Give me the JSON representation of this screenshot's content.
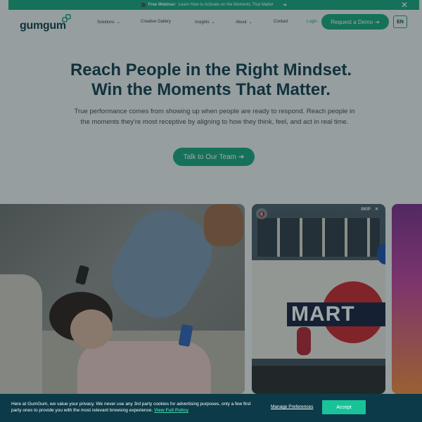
{
  "announcement": {
    "emoji": "🎥",
    "bold_label": "Free Webinar:",
    "text": "Learn How to Activate on the Moments That Matter",
    "arrow": "➜",
    "close": "✕"
  },
  "header": {
    "logo_text": "gumgum",
    "nav": [
      {
        "label": "Solutions",
        "has_chevron": true
      },
      {
        "label": "Creative Gallery",
        "has_chevron": false
      },
      {
        "label": "Insights",
        "has_chevron": true
      },
      {
        "label": "About",
        "has_chevron": true
      },
      {
        "label": "Contact",
        "has_chevron": false
      }
    ],
    "chevron": "⌄",
    "login": "Login",
    "demo_label": "Request a Demo",
    "demo_arrow": "➔",
    "lang": "EN"
  },
  "hero": {
    "title_line1": "Reach People in the Right Mindset.",
    "title_line2": "Win the Moments That Matter.",
    "subtitle": "True performance comes from showing up when people are ready to respond. Reach people in the moments they're most receptive by aligning to how they think, feel, and act in real time.",
    "cta_label": "Talk to Our Team",
    "cta_arrow": "➔"
  },
  "media": {
    "card2_word": "MART",
    "skip_label": "SKIP",
    "skip_close": "✕",
    "sound_icon": "🔇"
  },
  "cookie": {
    "text": "Here at GumGum, we value your privacy. We never use any 3rd party cookies for advertising purposes, only a few first party ones to provide you with the most relevant browsing experience.",
    "policy_link": "View Full Policy",
    "manage_label": "Manage Preferences",
    "accept_label": "Accept"
  },
  "colors": {
    "brand_green": "#16a57c",
    "navy": "#0f3c4a",
    "cookie_bg": "#0c3a48",
    "accept_green": "#19c39a"
  }
}
